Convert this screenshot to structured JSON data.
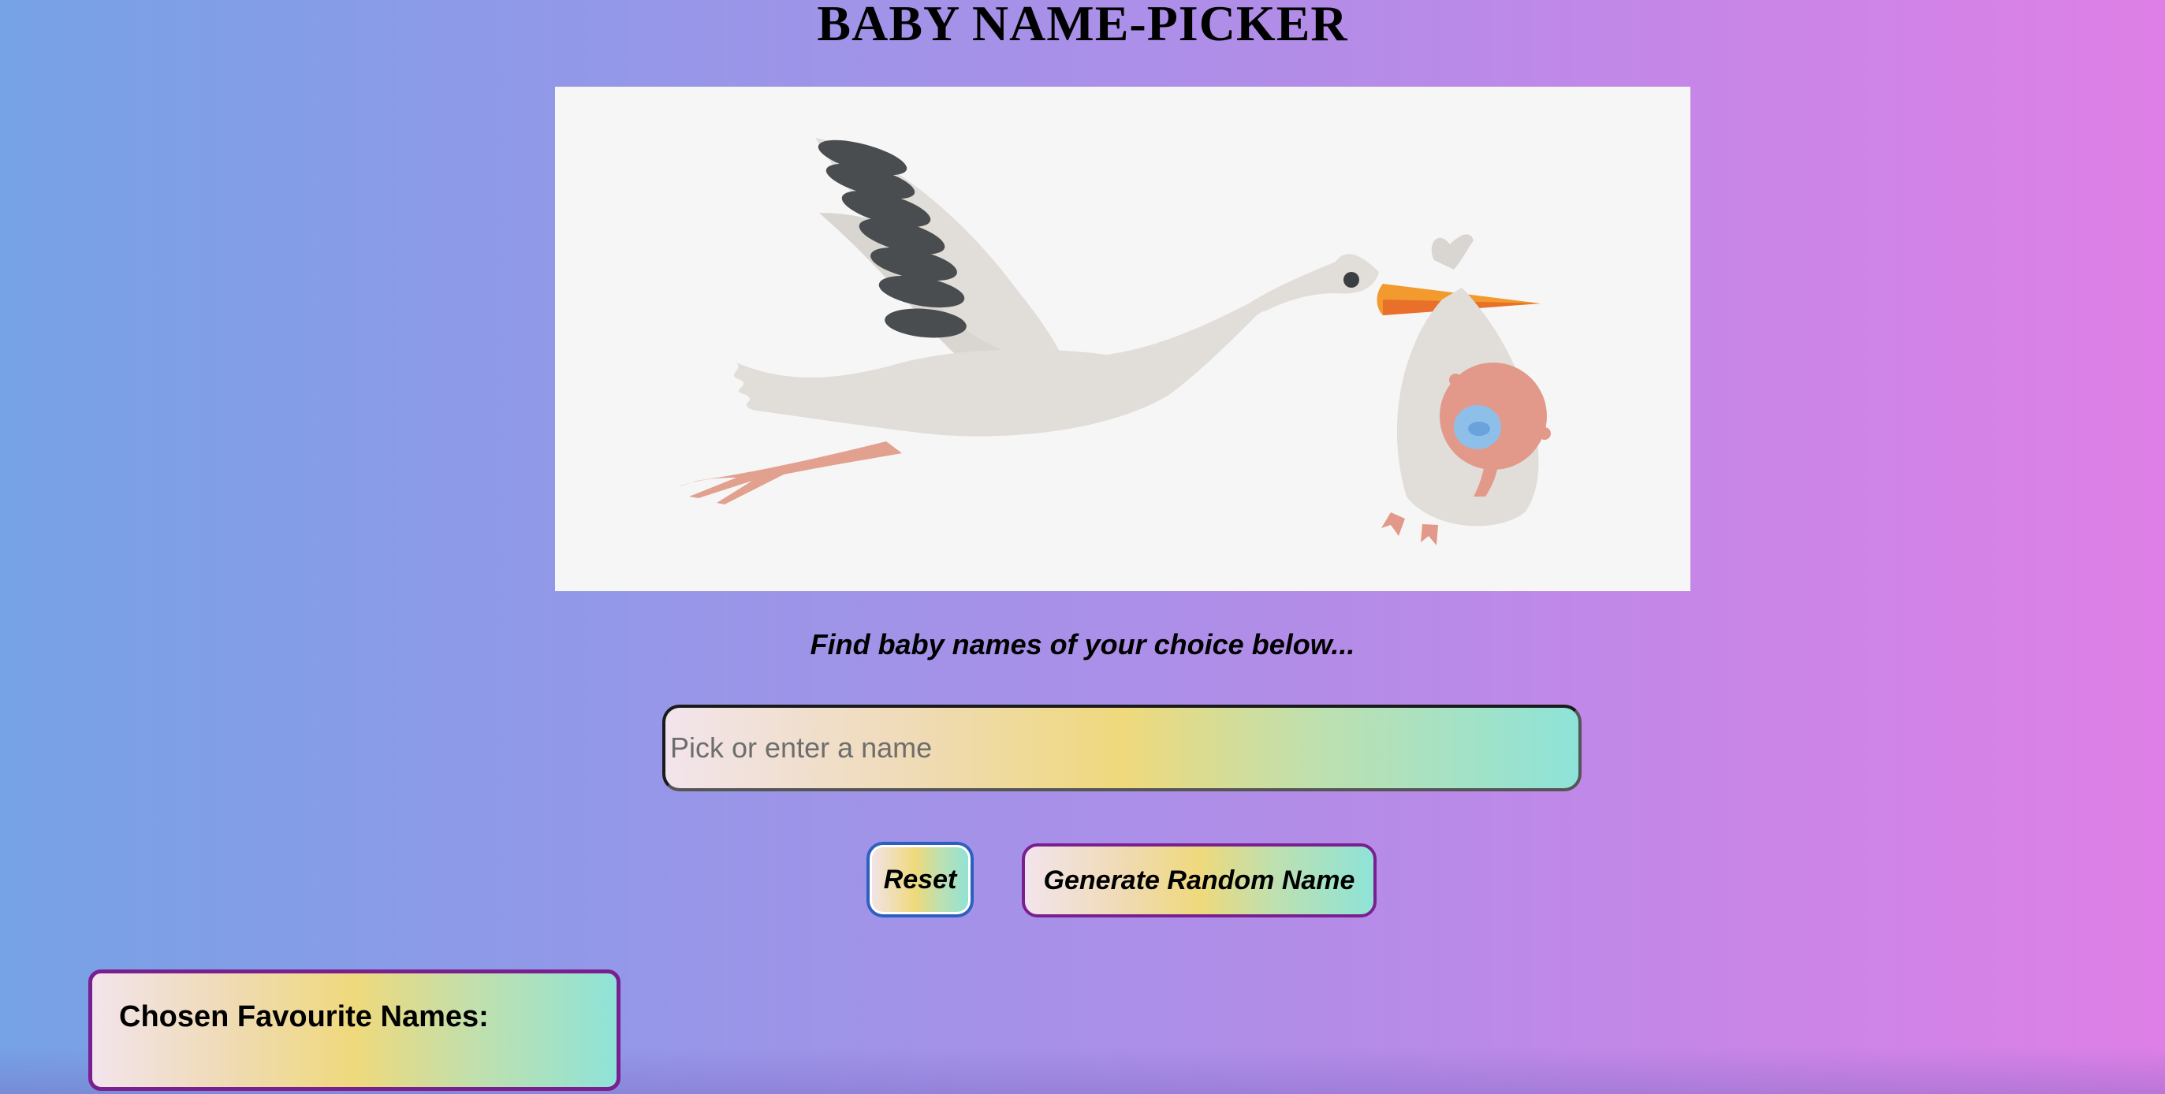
{
  "header": {
    "title": "BABY NAME-PICKER"
  },
  "hero": {
    "image_description_icon": "stork-carrying-baby-illustration"
  },
  "main": {
    "subtitle": "Find baby names of your choice below...",
    "search": {
      "value": "",
      "placeholder": "Pick or enter a name"
    },
    "buttons": {
      "reset_label": "Reset",
      "random_label": "Generate Random Name"
    }
  },
  "favourites": {
    "title": "Chosen Favourite Names:",
    "items": []
  },
  "colors": {
    "accent_border": "#7a1f8f",
    "reset_border": "#2c5fbf"
  }
}
